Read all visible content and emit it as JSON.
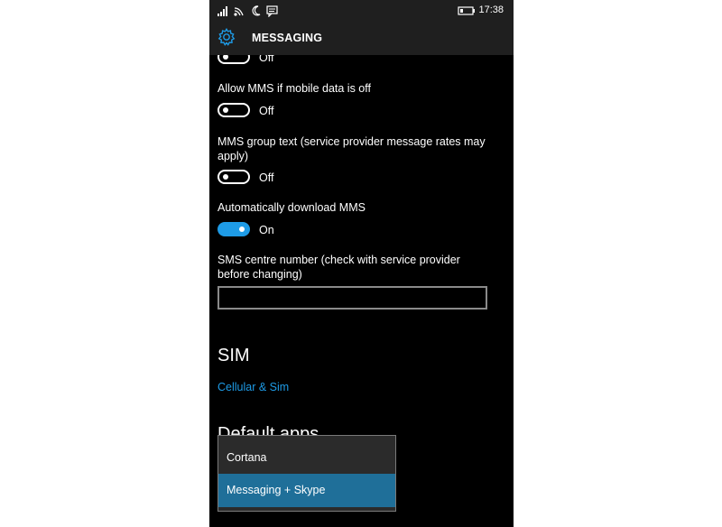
{
  "status_bar": {
    "time": "17:38",
    "icons": [
      "signal-icon",
      "wifi-icon",
      "moon-icon",
      "message-icon",
      "battery-icon"
    ]
  },
  "header": {
    "title": "MESSAGING",
    "icon": "gear-icon"
  },
  "settings": [
    {
      "label": "",
      "state": "Off",
      "on": false
    },
    {
      "label": "Allow MMS if mobile data is off",
      "state": "Off",
      "on": false
    },
    {
      "label": "MMS group text (service provider message rates may apply)",
      "state": "Off",
      "on": false
    },
    {
      "label": "Automatically download MMS",
      "state": "On",
      "on": true
    }
  ],
  "sms_centre": {
    "label": "SMS centre number (check with service provider before changing)",
    "value": ""
  },
  "sim": {
    "heading": "SIM",
    "link": "Cellular & Sim"
  },
  "default_apps": {
    "heading": "Default apps",
    "options": [
      "Cortana",
      "Messaging + Skype"
    ],
    "selected": "Messaging + Skype"
  },
  "colors": {
    "accent": "#1e9be6",
    "selected_option": "#1f6f99",
    "background": "#000000",
    "bar": "#1f1f1f"
  }
}
